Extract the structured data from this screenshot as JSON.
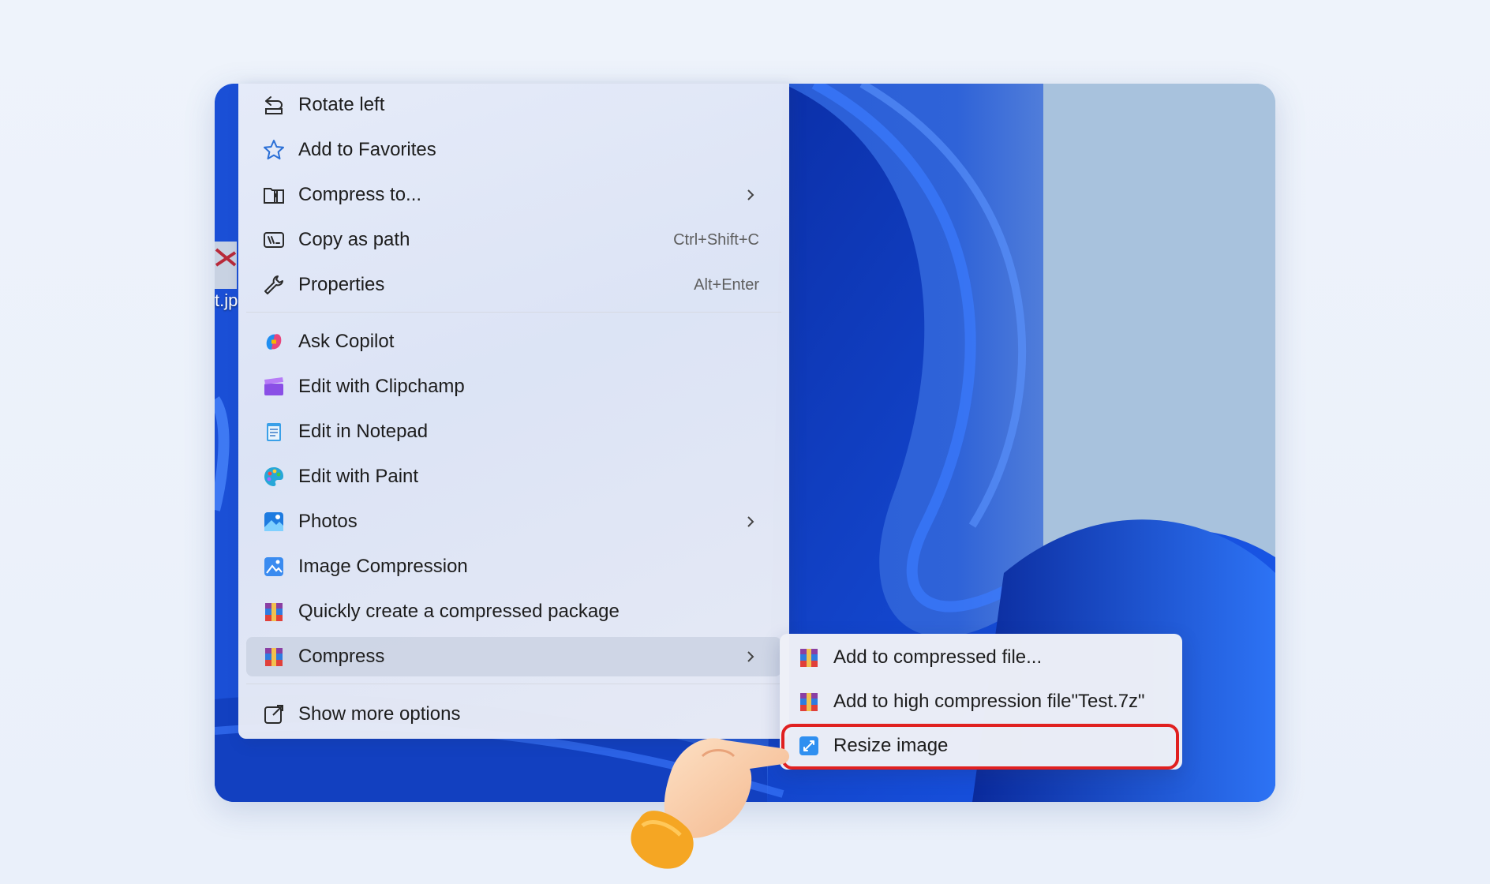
{
  "desktop": {
    "file_label": "t.jp"
  },
  "menu": {
    "items": [
      {
        "label": "Rotate left",
        "icon": "rotate-left-icon"
      },
      {
        "label": "Add to Favorites",
        "icon": "star-icon"
      },
      {
        "label": "Compress to...",
        "icon": "zip-folder-icon",
        "submenu": true
      },
      {
        "label": "Copy as path",
        "icon": "copy-path-icon",
        "shortcut": "Ctrl+Shift+C"
      },
      {
        "label": "Properties",
        "icon": "wrench-icon",
        "shortcut": "Alt+Enter"
      },
      {
        "label": "Ask Copilot",
        "icon": "copilot-icon"
      },
      {
        "label": "Edit with Clipchamp",
        "icon": "clipchamp-icon"
      },
      {
        "label": "Edit in Notepad",
        "icon": "notepad-icon"
      },
      {
        "label": "Edit with Paint",
        "icon": "paint-icon"
      },
      {
        "label": "Photos",
        "icon": "photos-icon",
        "submenu": true
      },
      {
        "label": "Image Compression",
        "icon": "image-compression-icon"
      },
      {
        "label": "Quickly create a compressed package",
        "icon": "winrar-icon"
      },
      {
        "label": "Compress",
        "icon": "winrar-icon",
        "submenu": true,
        "active": true
      },
      {
        "label": "Show more options",
        "icon": "show-more-icon"
      }
    ]
  },
  "submenu": {
    "items": [
      {
        "label": "Add to compressed file...",
        "icon": "winrar-icon"
      },
      {
        "label": "Add to high compression file\"Test.7z\"",
        "icon": "winrar-icon"
      },
      {
        "label": "Resize image",
        "icon": "resize-image-icon",
        "highlighted": true
      }
    ]
  },
  "colors": {
    "highlight": "#e02020",
    "wallpaper": "#1546c8"
  }
}
